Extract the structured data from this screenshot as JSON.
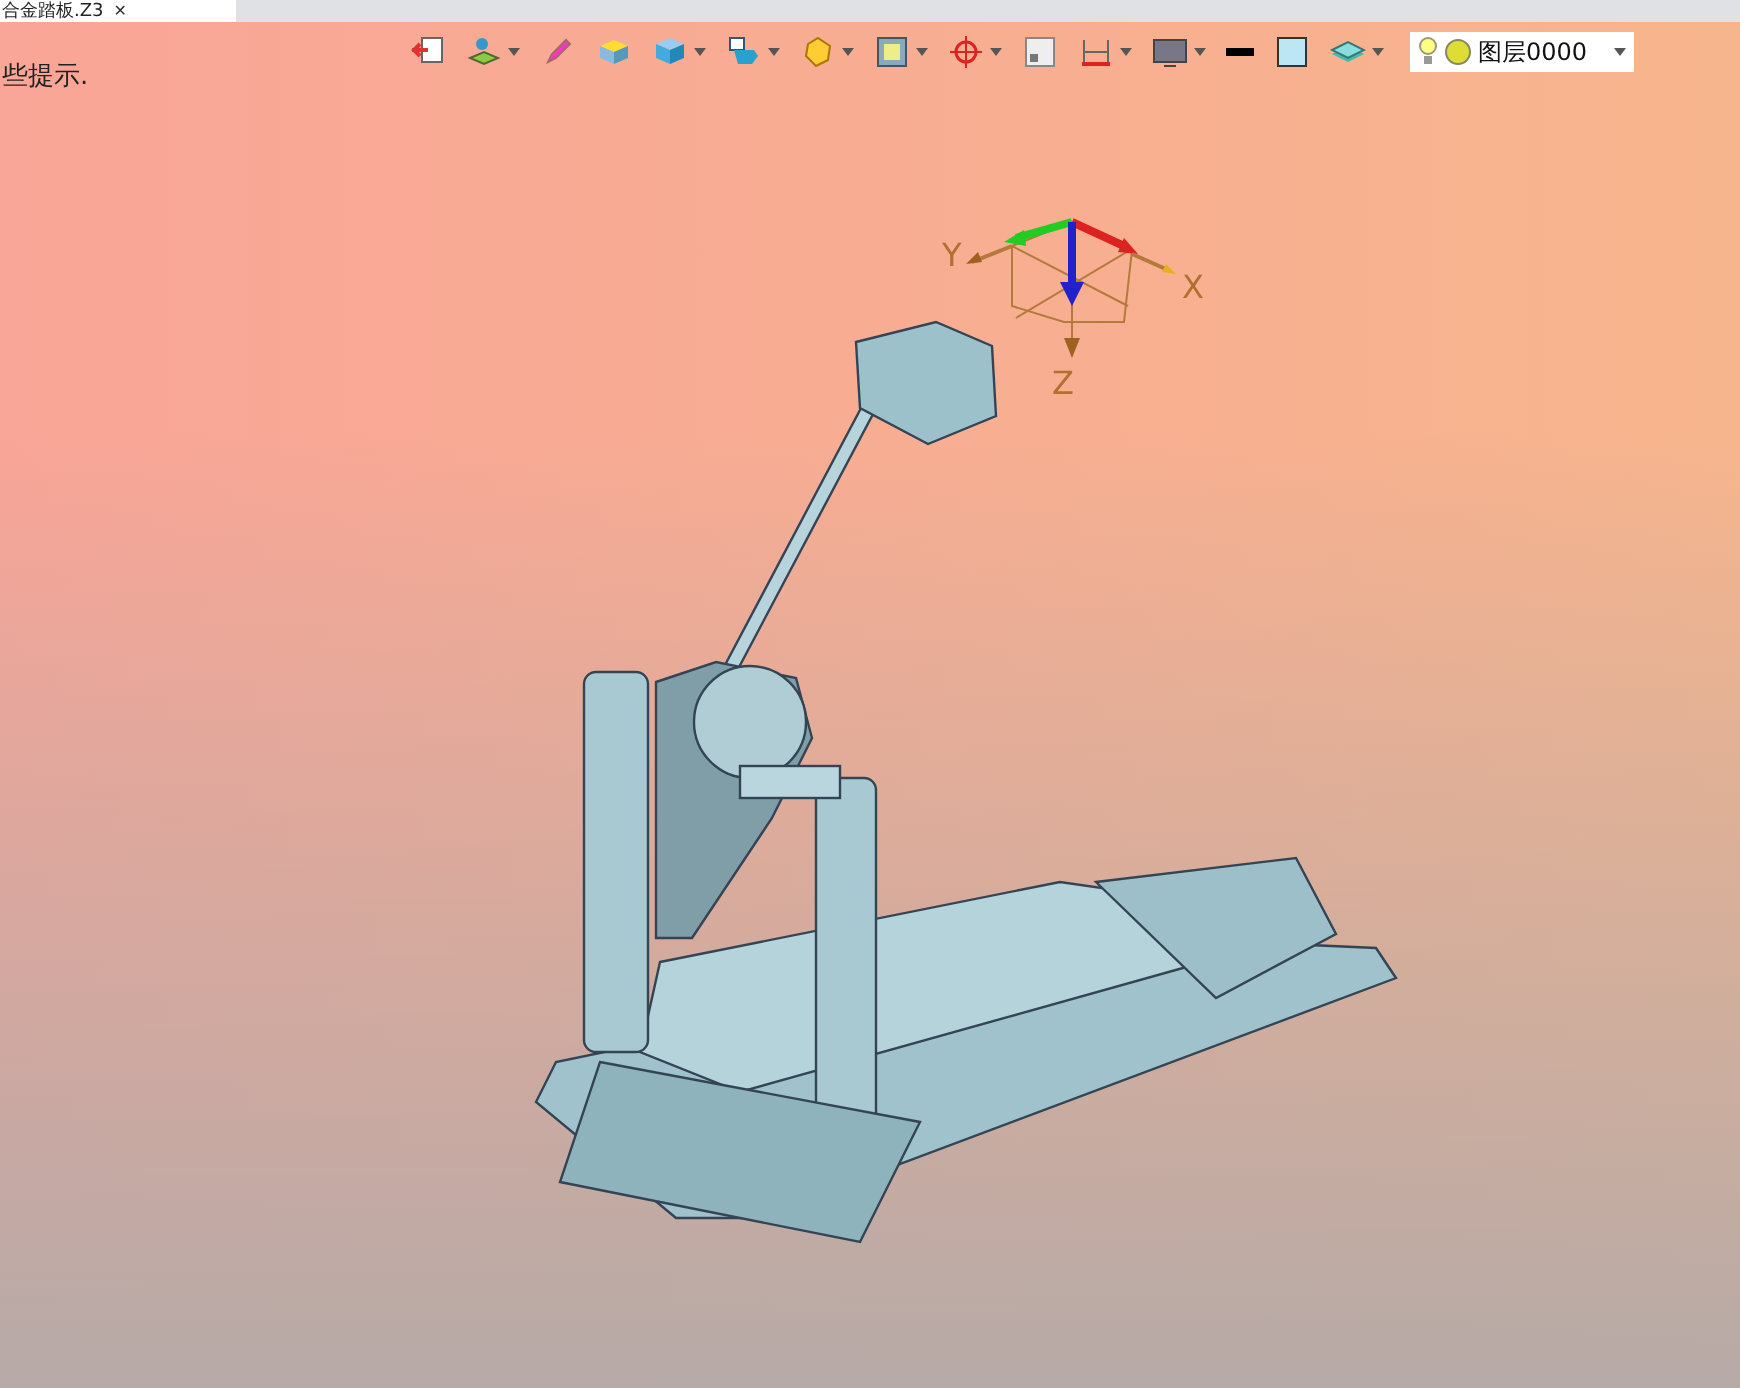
{
  "tabs": [
    {
      "label": "合金踏板.Z3",
      "selected": true,
      "close": "✕"
    }
  ],
  "toolbar": [
    {
      "menu": false
    },
    {
      "menu": true
    },
    {
      "menu": false
    },
    {
      "menu": false
    },
    {
      "menu": true
    },
    {
      "menu": true
    },
    {
      "menu": true
    },
    {
      "menu": true
    },
    {
      "menu": true
    },
    {
      "menu": false
    },
    {
      "menu": true
    },
    {
      "menu": true
    },
    {
      "menu": false
    },
    {
      "menu": false
    },
    {
      "menu": true
    }
  ],
  "layer_select": {
    "value": "图层0000"
  },
  "hint": "些提示.",
  "axes": {
    "x": "X",
    "y": "Y",
    "z": "Z"
  }
}
